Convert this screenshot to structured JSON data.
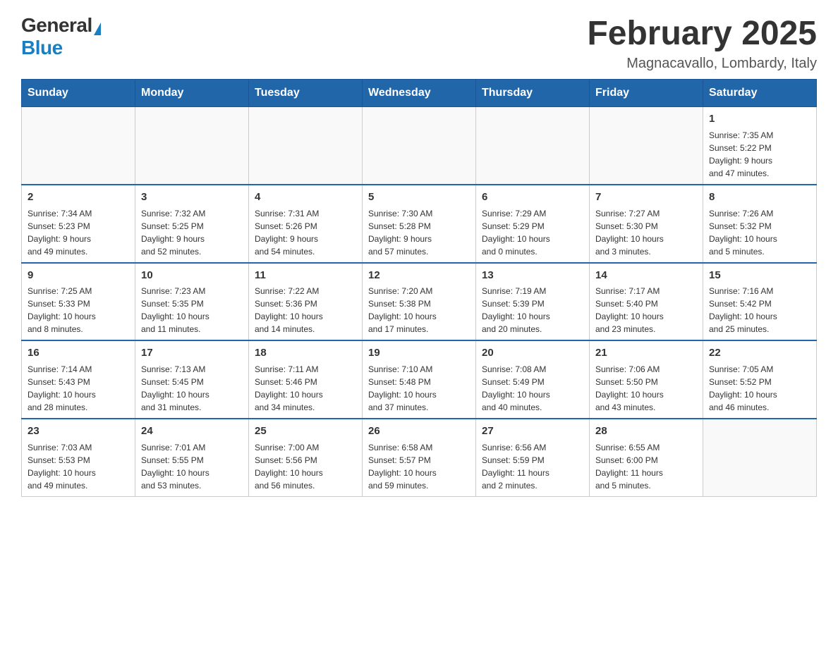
{
  "logo": {
    "general": "General",
    "blue": "Blue"
  },
  "title": "February 2025",
  "location": "Magnacavallo, Lombardy, Italy",
  "headers": [
    "Sunday",
    "Monday",
    "Tuesday",
    "Wednesday",
    "Thursday",
    "Friday",
    "Saturday"
  ],
  "weeks": [
    [
      {
        "day": "",
        "info": ""
      },
      {
        "day": "",
        "info": ""
      },
      {
        "day": "",
        "info": ""
      },
      {
        "day": "",
        "info": ""
      },
      {
        "day": "",
        "info": ""
      },
      {
        "day": "",
        "info": ""
      },
      {
        "day": "1",
        "info": "Sunrise: 7:35 AM\nSunset: 5:22 PM\nDaylight: 9 hours\nand 47 minutes."
      }
    ],
    [
      {
        "day": "2",
        "info": "Sunrise: 7:34 AM\nSunset: 5:23 PM\nDaylight: 9 hours\nand 49 minutes."
      },
      {
        "day": "3",
        "info": "Sunrise: 7:32 AM\nSunset: 5:25 PM\nDaylight: 9 hours\nand 52 minutes."
      },
      {
        "day": "4",
        "info": "Sunrise: 7:31 AM\nSunset: 5:26 PM\nDaylight: 9 hours\nand 54 minutes."
      },
      {
        "day": "5",
        "info": "Sunrise: 7:30 AM\nSunset: 5:28 PM\nDaylight: 9 hours\nand 57 minutes."
      },
      {
        "day": "6",
        "info": "Sunrise: 7:29 AM\nSunset: 5:29 PM\nDaylight: 10 hours\nand 0 minutes."
      },
      {
        "day": "7",
        "info": "Sunrise: 7:27 AM\nSunset: 5:30 PM\nDaylight: 10 hours\nand 3 minutes."
      },
      {
        "day": "8",
        "info": "Sunrise: 7:26 AM\nSunset: 5:32 PM\nDaylight: 10 hours\nand 5 minutes."
      }
    ],
    [
      {
        "day": "9",
        "info": "Sunrise: 7:25 AM\nSunset: 5:33 PM\nDaylight: 10 hours\nand 8 minutes."
      },
      {
        "day": "10",
        "info": "Sunrise: 7:23 AM\nSunset: 5:35 PM\nDaylight: 10 hours\nand 11 minutes."
      },
      {
        "day": "11",
        "info": "Sunrise: 7:22 AM\nSunset: 5:36 PM\nDaylight: 10 hours\nand 14 minutes."
      },
      {
        "day": "12",
        "info": "Sunrise: 7:20 AM\nSunset: 5:38 PM\nDaylight: 10 hours\nand 17 minutes."
      },
      {
        "day": "13",
        "info": "Sunrise: 7:19 AM\nSunset: 5:39 PM\nDaylight: 10 hours\nand 20 minutes."
      },
      {
        "day": "14",
        "info": "Sunrise: 7:17 AM\nSunset: 5:40 PM\nDaylight: 10 hours\nand 23 minutes."
      },
      {
        "day": "15",
        "info": "Sunrise: 7:16 AM\nSunset: 5:42 PM\nDaylight: 10 hours\nand 25 minutes."
      }
    ],
    [
      {
        "day": "16",
        "info": "Sunrise: 7:14 AM\nSunset: 5:43 PM\nDaylight: 10 hours\nand 28 minutes."
      },
      {
        "day": "17",
        "info": "Sunrise: 7:13 AM\nSunset: 5:45 PM\nDaylight: 10 hours\nand 31 minutes."
      },
      {
        "day": "18",
        "info": "Sunrise: 7:11 AM\nSunset: 5:46 PM\nDaylight: 10 hours\nand 34 minutes."
      },
      {
        "day": "19",
        "info": "Sunrise: 7:10 AM\nSunset: 5:48 PM\nDaylight: 10 hours\nand 37 minutes."
      },
      {
        "day": "20",
        "info": "Sunrise: 7:08 AM\nSunset: 5:49 PM\nDaylight: 10 hours\nand 40 minutes."
      },
      {
        "day": "21",
        "info": "Sunrise: 7:06 AM\nSunset: 5:50 PM\nDaylight: 10 hours\nand 43 minutes."
      },
      {
        "day": "22",
        "info": "Sunrise: 7:05 AM\nSunset: 5:52 PM\nDaylight: 10 hours\nand 46 minutes."
      }
    ],
    [
      {
        "day": "23",
        "info": "Sunrise: 7:03 AM\nSunset: 5:53 PM\nDaylight: 10 hours\nand 49 minutes."
      },
      {
        "day": "24",
        "info": "Sunrise: 7:01 AM\nSunset: 5:55 PM\nDaylight: 10 hours\nand 53 minutes."
      },
      {
        "day": "25",
        "info": "Sunrise: 7:00 AM\nSunset: 5:56 PM\nDaylight: 10 hours\nand 56 minutes."
      },
      {
        "day": "26",
        "info": "Sunrise: 6:58 AM\nSunset: 5:57 PM\nDaylight: 10 hours\nand 59 minutes."
      },
      {
        "day": "27",
        "info": "Sunrise: 6:56 AM\nSunset: 5:59 PM\nDaylight: 11 hours\nand 2 minutes."
      },
      {
        "day": "28",
        "info": "Sunrise: 6:55 AM\nSunset: 6:00 PM\nDaylight: 11 hours\nand 5 minutes."
      },
      {
        "day": "",
        "info": ""
      }
    ]
  ]
}
